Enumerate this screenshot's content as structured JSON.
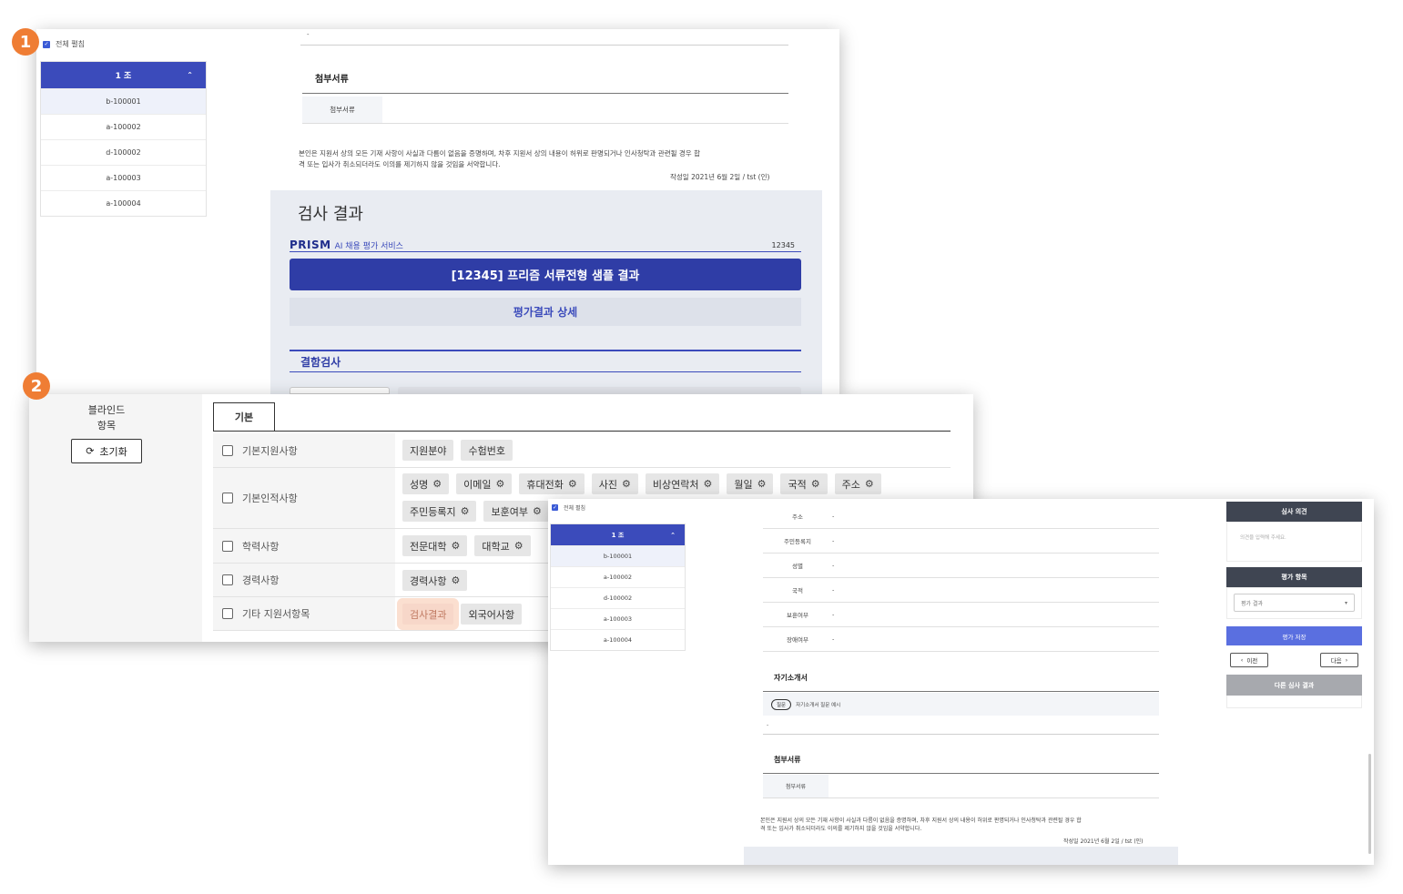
{
  "badges": {
    "one": "1",
    "two": "2"
  },
  "colors": {
    "badge": "#ef7d34",
    "primary": "#3b4bbb",
    "dark_button": "#2f3da6",
    "highlight": "#f7d7c9"
  },
  "panel1": {
    "select_all_label": "전체 펼침",
    "group": {
      "label": "1 조",
      "chevron_icon": "chevron-up-icon"
    },
    "applicants": [
      "b-100001",
      "a-100002",
      "d-100002",
      "a-100003",
      "a-100004"
    ],
    "top_dash": "-",
    "attachments_title": "첨부서류",
    "attachments_label": "첨부서류",
    "pledge_line1": "본인은 지원서 상의 모든 기재 사항이 사실과 다름이 없음을 증명하며, 차후 지원서 상의 내용이 허위로 판명되거나 인사청탁과 관련될 경우 합",
    "pledge_line2": "격 또는 입사가 취소되더라도 이의를 제기하지 않을 것임을 서약합니다.",
    "signed": "작성일 2021년 6월 2일 / tst (인)",
    "result": {
      "title": "검사 결과",
      "logo": "PRISM",
      "service": "AI 채용 평가 서비스",
      "code": "12345",
      "main_button": "[12345] 프리즘 서류전형 샘플 결과",
      "detail_button": "평가결과 상세",
      "defect_title": "결함검사"
    }
  },
  "panel2": {
    "blind_title_line1": "블라인드",
    "blind_title_line2": "항목",
    "reset_label": "초기화",
    "tab_label": "기본",
    "rows": [
      {
        "label": "기본지원사항",
        "chips": [
          "지원분야",
          "수험번호"
        ]
      },
      {
        "label": "기본인적사항",
        "chips": [
          "성명",
          "이메일",
          "휴대전화",
          "사진",
          "비상연락처",
          "월일",
          "국적",
          "주소",
          "주민등록지",
          "보훈여부"
        ]
      },
      {
        "label": "학력사항",
        "chips": [
          "전문대학",
          "대학교"
        ]
      },
      {
        "label": "경력사항",
        "chips": [
          "경력사항"
        ]
      },
      {
        "label": "기타 지원서항목",
        "chips": [
          "검사결과",
          "외국어사항"
        ]
      }
    ]
  },
  "panel3": {
    "select_all_label": "전체 펼침",
    "group": {
      "label": "1 조"
    },
    "applicants": [
      "b-100001",
      "a-100002",
      "d-100002",
      "a-100003",
      "a-100004"
    ],
    "fields": [
      {
        "label": "주소",
        "value": "-"
      },
      {
        "label": "주민등록지",
        "value": "-"
      },
      {
        "label": "성별",
        "value": "-"
      },
      {
        "label": "국적",
        "value": "-"
      },
      {
        "label": "보훈여부",
        "value": "-"
      },
      {
        "label": "장애여부",
        "value": "-"
      }
    ],
    "cover_letter_title": "자기소개서",
    "question_badge": "질문",
    "question_text": "자기소개서 질문 예시",
    "answer": "-",
    "attachments_title": "첨부서류",
    "attachments_label": "첨부서류",
    "pledge_line1": "본인은 지원서 상의 모든 기재 사항이 사실과 다름이 없음을 증명하며, 차후 지원서 상의 내용이 허위로 판명되거나 인사청탁과 관련될 경우 합",
    "pledge_line2": "격 또는 입사가 취소되더라도 이의를 제기하지 않을 것임을 서약합니다.",
    "signed": "작성일 2021년 6월 2일 / tst (인)",
    "sidebar": {
      "opinion_title": "심사 의견",
      "opinion_placeholder": "의견을 입력해 주세요.",
      "eval_title": "평가 항목",
      "eval_selected": "평가 결과",
      "save_label": "평가 저장",
      "prev_label": "이전",
      "next_label": "다음",
      "other_label": "다른 심사 결과"
    }
  }
}
